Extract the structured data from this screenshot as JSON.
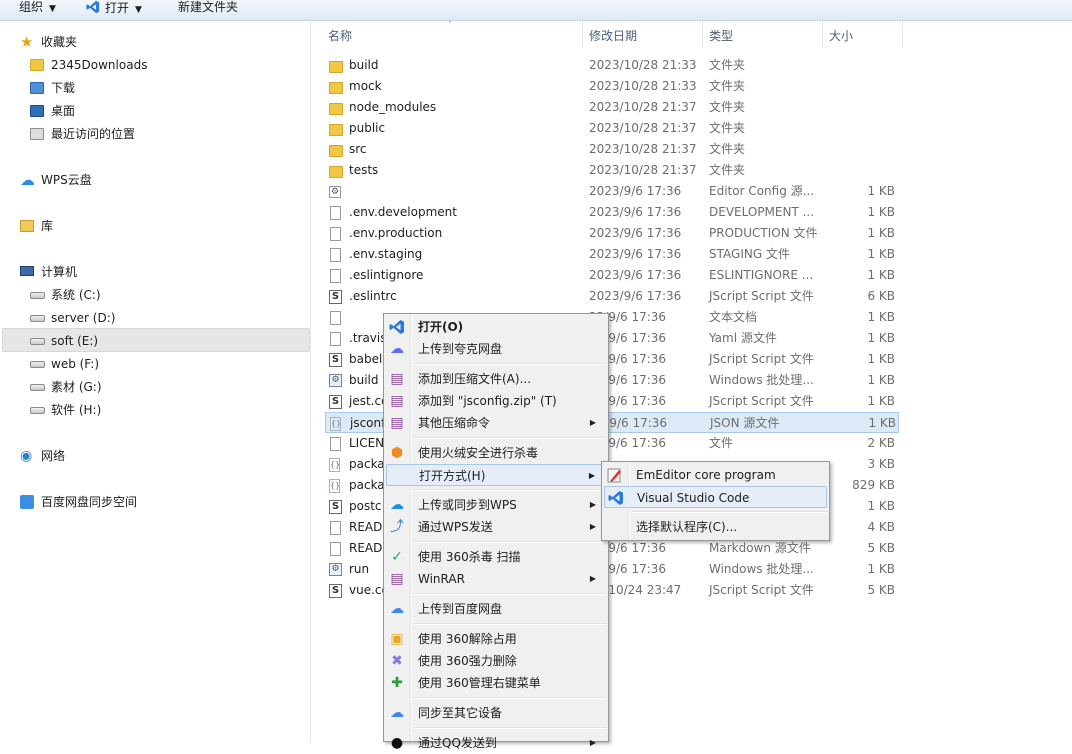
{
  "toolbar": {
    "organize": "组织",
    "open": "打开",
    "new_folder": "新建文件夹"
  },
  "nav": {
    "favorites": "收藏夹",
    "fav_items": [
      "2345Downloads",
      "下载",
      "桌面",
      "最近访问的位置"
    ],
    "wps_cloud": "WPS云盘",
    "library": "库",
    "computer": "计算机",
    "drives": [
      "系统 (C:)",
      "server (D:)",
      "soft (E:)",
      "web (F:)",
      "素材 (G:)",
      "软件 (H:)"
    ],
    "network": "网络",
    "baidu_sync": "百度网盘同步空间"
  },
  "columns": {
    "name": "名称",
    "date": "修改日期",
    "type": "类型",
    "size": "大小"
  },
  "files": [
    {
      "name": "build",
      "date": "2023/10/28 21:33",
      "type": "文件夹",
      "size": "",
      "icon": "folder-icon"
    },
    {
      "name": "mock",
      "date": "2023/10/28 21:33",
      "type": "文件夹",
      "size": "",
      "icon": "folder-icon"
    },
    {
      "name": "node_modules",
      "date": "2023/10/28 21:37",
      "type": "文件夹",
      "size": "",
      "icon": "folder-icon"
    },
    {
      "name": "public",
      "date": "2023/10/28 21:37",
      "type": "文件夹",
      "size": "",
      "icon": "folder-icon"
    },
    {
      "name": "src",
      "date": "2023/10/28 21:37",
      "type": "文件夹",
      "size": "",
      "icon": "folder-icon"
    },
    {
      "name": "tests",
      "date": "2023/10/28 21:37",
      "type": "文件夹",
      "size": "",
      "icon": "folder-icon"
    },
    {
      "name": "",
      "date": "2023/9/6 17:36",
      "type": "Editor Config 源...",
      "size": "1 KB",
      "icon": "config-file-icon"
    },
    {
      "name": ".env.development",
      "date": "2023/9/6 17:36",
      "type": "DEVELOPMENT ...",
      "size": "1 KB",
      "icon": "file-icon"
    },
    {
      "name": ".env.production",
      "date": "2023/9/6 17:36",
      "type": "PRODUCTION 文件",
      "size": "1 KB",
      "icon": "file-icon"
    },
    {
      "name": ".env.staging",
      "date": "2023/9/6 17:36",
      "type": "STAGING 文件",
      "size": "1 KB",
      "icon": "file-icon"
    },
    {
      "name": ".eslintignore",
      "date": "2023/9/6 17:36",
      "type": "ESLINTIGNORE ...",
      "size": "1 KB",
      "icon": "file-icon"
    },
    {
      "name": ".eslintrc",
      "date": "2023/9/6 17:36",
      "type": "JScript Script 文件",
      "size": "6 KB",
      "icon": "jscript-file-icon"
    },
    {
      "name": "",
      "date": "23/9/6 17:36",
      "type": "文本文档",
      "size": "1 KB",
      "icon": "file-icon"
    },
    {
      "name": ".travis",
      "date": "23/9/6 17:36",
      "type": "Yaml 源文件",
      "size": "1 KB",
      "icon": "file-icon"
    },
    {
      "name": "babel",
      "date": "23/9/6 17:36",
      "type": "JScript Script 文件",
      "size": "1 KB",
      "icon": "jscript-file-icon"
    },
    {
      "name": "build",
      "date": "23/9/6 17:36",
      "type": "Windows 批处理...",
      "size": "1 KB",
      "icon": "batch-file-icon"
    },
    {
      "name": "jest.co",
      "date": "23/9/6 17:36",
      "type": "JScript Script 文件",
      "size": "1 KB",
      "icon": "jscript-file-icon"
    },
    {
      "name": "jsconf",
      "date": "23/9/6 17:36",
      "type": "JSON 源文件",
      "size": "1 KB",
      "icon": "json-file-icon",
      "selected": true
    },
    {
      "name": "LICEN",
      "date": "23/9/6 17:36",
      "type": "文件",
      "size": "2 KB",
      "icon": "file-icon"
    },
    {
      "name": "packa",
      "date": "",
      "type": "",
      "size": "3 KB",
      "icon": "json-file-icon"
    },
    {
      "name": "packa",
      "date": "",
      "type": "",
      "size": "829 KB",
      "icon": "json-file-icon"
    },
    {
      "name": "postc",
      "date": "",
      "type": "",
      "size": "1 KB",
      "icon": "jscript-file-icon"
    },
    {
      "name": "READI",
      "date": "",
      "type": "",
      "size": "4 KB",
      "icon": "file-icon"
    },
    {
      "name": "READI",
      "date": "23/9/6 17:36",
      "type": "Markdown 源文件",
      "size": "5 KB",
      "icon": "file-icon"
    },
    {
      "name": "run",
      "date": "23/9/6 17:36",
      "type": "Windows 批处理...",
      "size": "1 KB",
      "icon": "batch-file-icon"
    },
    {
      "name": "vue.co",
      "date": "23/10/24 23:47",
      "type": "JScript Script 文件",
      "size": "5 KB",
      "icon": "jscript-file-icon"
    }
  ],
  "context_menu": [
    {
      "label": "打开(O)",
      "icon": "vscode-icon",
      "bold": true
    },
    {
      "label": "上传到夸克网盘",
      "icon": "quark-cloud-icon"
    },
    {
      "sep": true
    },
    {
      "label": "添加到压缩文件(A)...",
      "icon": "winrar-icon"
    },
    {
      "label": "添加到 \"jsconfig.zip\" (T)",
      "icon": "winrar-icon"
    },
    {
      "label": "其他压缩命令",
      "icon": "winrar-icon",
      "sub": true
    },
    {
      "sep": true
    },
    {
      "label": "使用火绒安全进行杀毒",
      "icon": "huorong-icon"
    },
    {
      "label": "打开方式(H)",
      "icon": "",
      "sub": true,
      "hl": true
    },
    {
      "sep": true
    },
    {
      "label": "上传或同步到WPS",
      "icon": "wps-cloud-icon",
      "sub": true
    },
    {
      "label": "通过WPS发送",
      "icon": "wps-share-icon",
      "sub": true
    },
    {
      "sep": true
    },
    {
      "label": "使用 360杀毒 扫描",
      "icon": "360-antivirus-icon"
    },
    {
      "label": "WinRAR",
      "icon": "winrar-icon",
      "sub": true
    },
    {
      "sep": true
    },
    {
      "label": "上传到百度网盘",
      "icon": "baidu-cloud-icon"
    },
    {
      "sep": true
    },
    {
      "label": "使用 360解除占用",
      "icon": "360-unlock-icon"
    },
    {
      "label": "使用 360强力删除",
      "icon": "360-delete-icon"
    },
    {
      "label": "使用 360管理右键菜单",
      "icon": "360-manage-icon"
    },
    {
      "sep": true
    },
    {
      "label": "同步至其它设备",
      "icon": "baidu-sync-icon"
    },
    {
      "sep": true
    },
    {
      "label": "通过QQ发送到",
      "icon": "qq-icon",
      "sub": true
    }
  ],
  "open_with_menu": [
    {
      "label": "EmEditor core program",
      "icon": "emeditor-icon"
    },
    {
      "label": "Visual Studio Code",
      "icon": "vscode-icon",
      "hl": true
    },
    {
      "sep": true
    },
    {
      "label": "选择默认程序(C)...",
      "icon": ""
    }
  ],
  "colors": {
    "selection": "#dceaf7",
    "vscode_blue": "#2b7bd6",
    "folder_yellow": "#f2c744"
  }
}
